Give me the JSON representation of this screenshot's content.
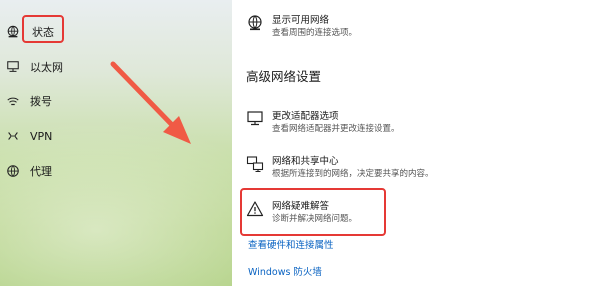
{
  "sidebar": {
    "items": [
      {
        "label": "状态",
        "icon": "globe-status-icon"
      },
      {
        "label": "以太网",
        "icon": "ethernet-icon"
      },
      {
        "label": "拨号",
        "icon": "dialup-icon"
      },
      {
        "label": "VPN",
        "icon": "vpn-icon"
      },
      {
        "label": "代理",
        "icon": "proxy-globe-icon"
      }
    ]
  },
  "main": {
    "available_networks": {
      "title": "显示可用网络",
      "desc": "查看周围的连接选项。"
    },
    "section_title": "高级网络设置",
    "adapter": {
      "title": "更改适配器选项",
      "desc": "查看网络适配器并更改连接设置。"
    },
    "sharing_center": {
      "title": "网络和共享中心",
      "desc": "根据所连接到的网络，决定要共享的内容。"
    },
    "troubleshoot": {
      "title": "网络疑难解答",
      "desc": "诊断并解决网络问题。"
    },
    "link_hardware": "查看硬件和连接属性",
    "link_firewall": "Windows 防火墙"
  },
  "colors": {
    "highlight": "#e53935",
    "link": "#0a63c2"
  }
}
